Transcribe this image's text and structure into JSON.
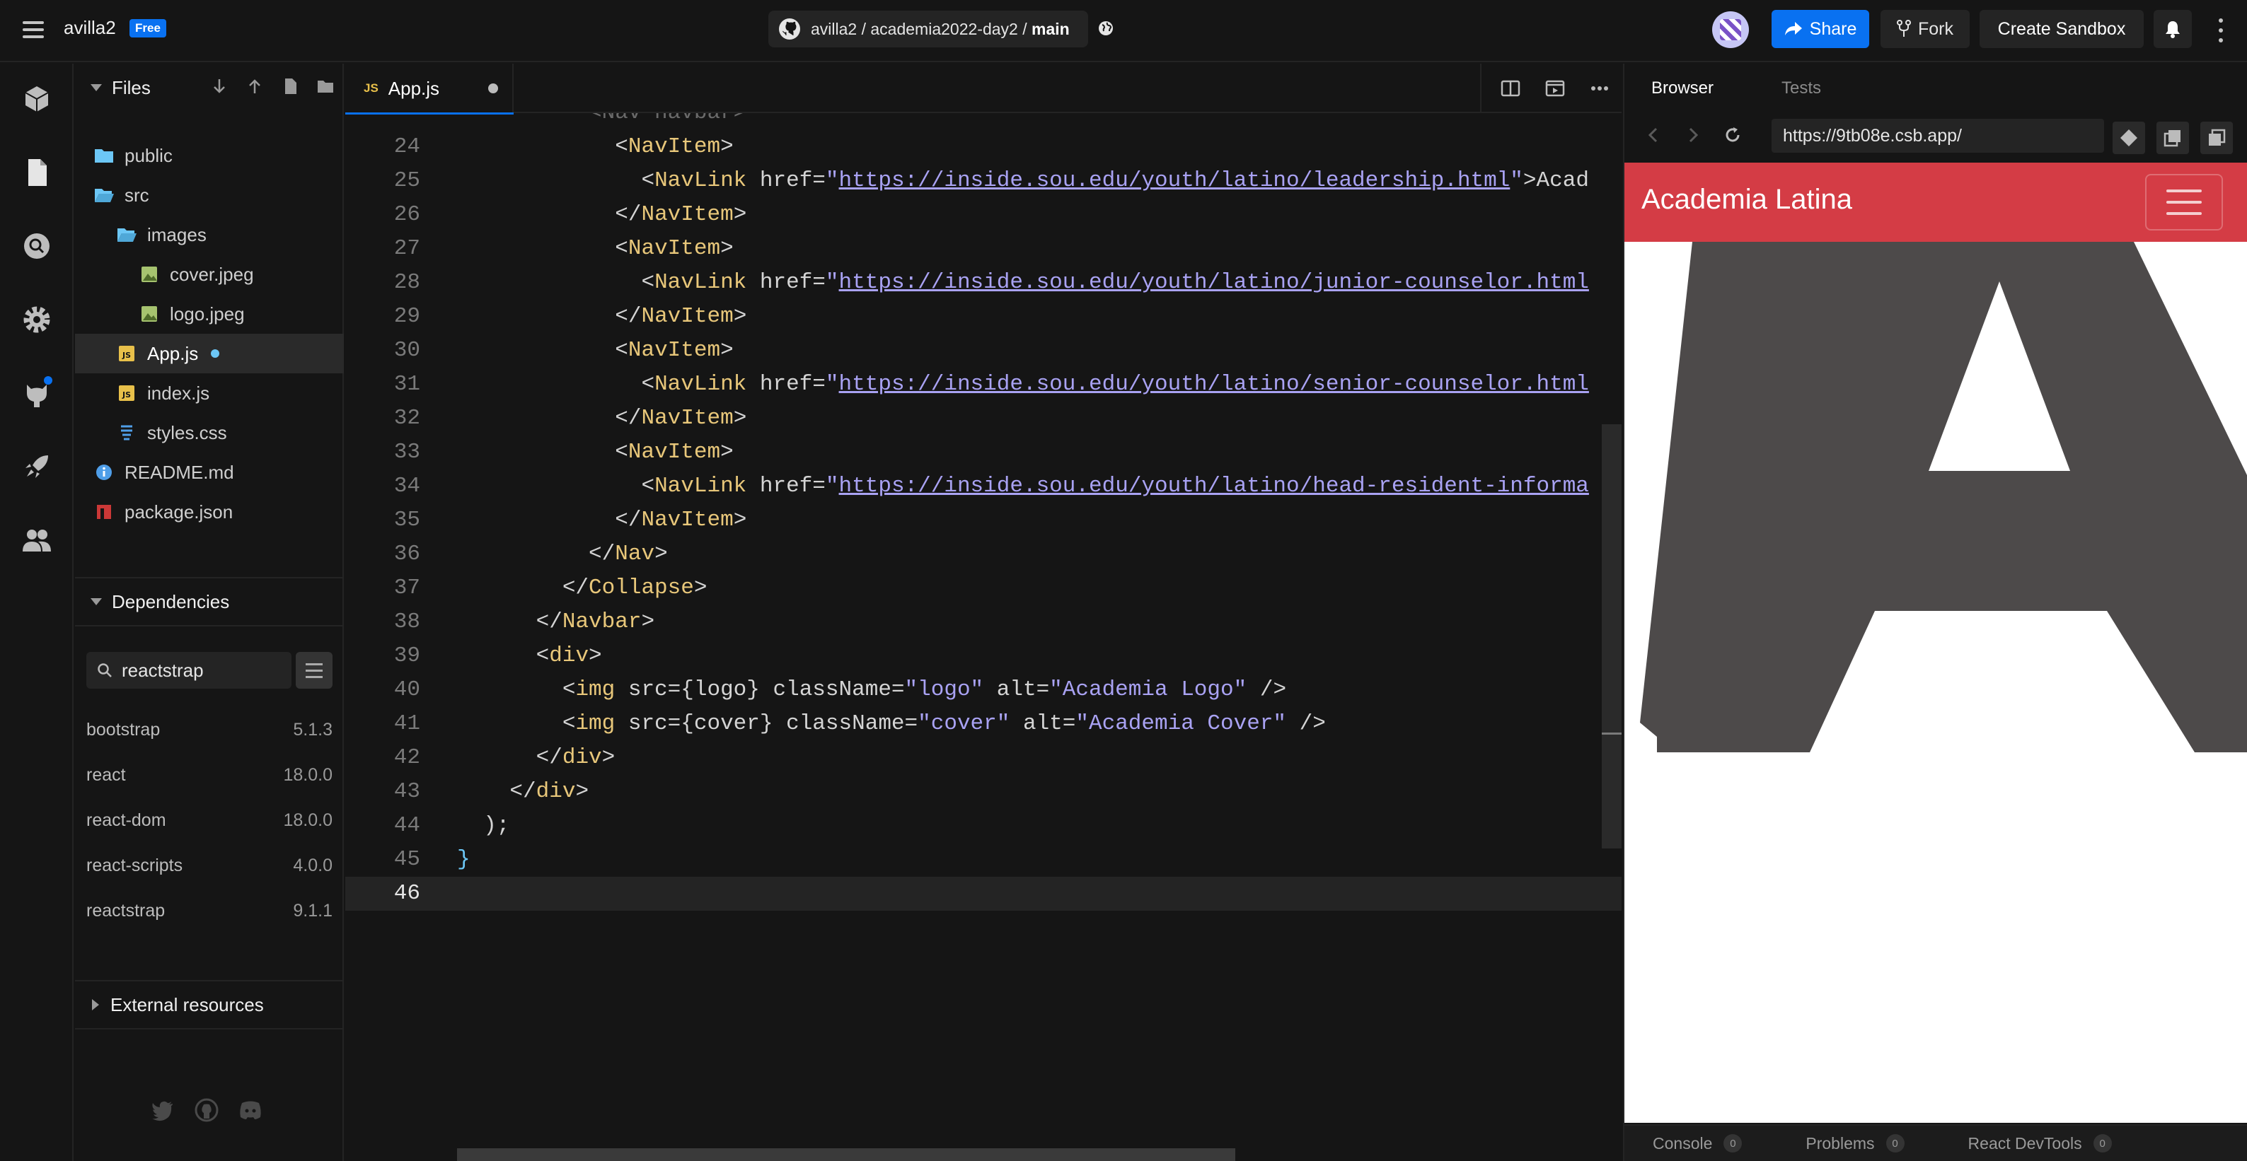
{
  "header": {
    "username": "avilla2",
    "plan_badge": "Free",
    "repo_owner": "avilla2",
    "repo_name": "academia2022-day2",
    "repo_branch": "main",
    "share_label": "Share",
    "fork_label": "Fork",
    "create_label": "Create Sandbox"
  },
  "explorer": {
    "title": "Files",
    "tree": [
      {
        "label": "public",
        "kind": "folder"
      },
      {
        "label": "src",
        "kind": "folder-open"
      },
      {
        "label": "images",
        "kind": "folder-open"
      },
      {
        "label": "cover.jpeg",
        "kind": "image"
      },
      {
        "label": "logo.jpeg",
        "kind": "image"
      },
      {
        "label": "App.js",
        "kind": "js",
        "active": true,
        "modified": true
      },
      {
        "label": "index.js",
        "kind": "js"
      },
      {
        "label": "styles.css",
        "kind": "css"
      },
      {
        "label": "README.md",
        "kind": "info"
      },
      {
        "label": "package.json",
        "kind": "npm"
      }
    ],
    "dependencies": {
      "title": "Dependencies",
      "search_value": "reactstrap",
      "items": [
        {
          "name": "bootstrap",
          "version": "5.1.3"
        },
        {
          "name": "react",
          "version": "18.0.0"
        },
        {
          "name": "react-dom",
          "version": "18.0.0"
        },
        {
          "name": "react-scripts",
          "version": "4.0.0"
        },
        {
          "name": "reactstrap",
          "version": "9.1.1"
        }
      ]
    },
    "external_title": "External resources"
  },
  "editor": {
    "tab_badge": "JS",
    "tab_label": "App.js",
    "lines": [
      {
        "n": "24",
        "code": "            <NavItem>"
      },
      {
        "n": "25",
        "code": "              <NavLink href=\"https://inside.sou.edu/youth/latino/leadership.html\">Acad"
      },
      {
        "n": "26",
        "code": "            </NavItem>"
      },
      {
        "n": "27",
        "code": "            <NavItem>"
      },
      {
        "n": "28",
        "code": "              <NavLink href=\"https://inside.sou.edu/youth/latino/junior-counselor.html"
      },
      {
        "n": "29",
        "code": "            </NavItem>"
      },
      {
        "n": "30",
        "code": "            <NavItem>"
      },
      {
        "n": "31",
        "code": "              <NavLink href=\"https://inside.sou.edu/youth/latino/senior-counselor.html"
      },
      {
        "n": "32",
        "code": "            </NavItem>"
      },
      {
        "n": "33",
        "code": "            <NavItem>"
      },
      {
        "n": "34",
        "code": "              <NavLink href=\"https://inside.sou.edu/youth/latino/head-resident-informa"
      },
      {
        "n": "35",
        "code": "            </NavItem>"
      },
      {
        "n": "36",
        "code": "          </Nav>"
      },
      {
        "n": "37",
        "code": "        </Collapse>"
      },
      {
        "n": "38",
        "code": "      </Navbar>"
      },
      {
        "n": "39",
        "code": "      <div>"
      },
      {
        "n": "40",
        "code": "        <img src={logo} className=\"logo\" alt=\"Academia Logo\" />"
      },
      {
        "n": "41",
        "code": "        <img src={cover} className=\"cover\" alt=\"Academia Cover\" />"
      },
      {
        "n": "42",
        "code": "      </div>"
      },
      {
        "n": "43",
        "code": "    </div>"
      },
      {
        "n": "44",
        "code": "  );"
      },
      {
        "n": "45",
        "code": "}"
      },
      {
        "n": "46",
        "code": ""
      }
    ],
    "current_line": "46"
  },
  "preview": {
    "tab_browser": "Browser",
    "tab_tests": "Tests",
    "url": "https://9tb08e.csb.app/",
    "site_brand": "Academia Latina",
    "bottom_tabs": [
      {
        "label": "Console",
        "count": "0"
      },
      {
        "label": "Problems",
        "count": "0"
      },
      {
        "label": "React DevTools",
        "count": "0"
      }
    ]
  },
  "colors": {
    "accent": "#0971f1",
    "site_navbar": "#d43c45",
    "logo_gray": "#4d4a4a"
  }
}
